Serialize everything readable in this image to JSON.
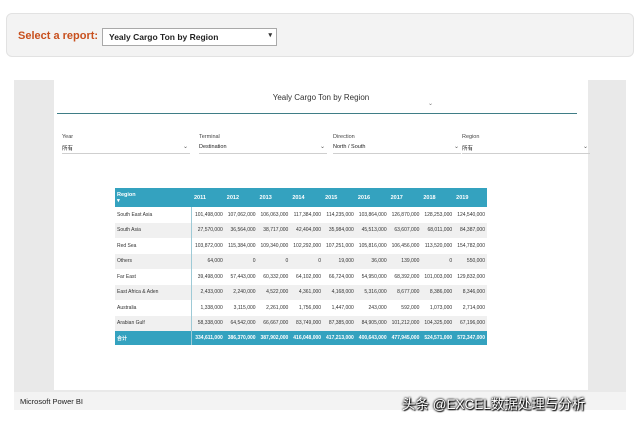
{
  "header": {
    "select_label": "Select a report:",
    "selected_report": "Yealy Cargo Ton by Region"
  },
  "report": {
    "title": "Yealy Cargo Ton by Region",
    "slicers": [
      {
        "label": "Year",
        "value": "所有"
      },
      {
        "label": "Terminal",
        "value": "Destination"
      },
      {
        "label": "Direction",
        "value": "North / South"
      },
      {
        "label": "Region",
        "value": "所有"
      }
    ],
    "table": {
      "columns": [
        "Region",
        "2011",
        "2012",
        "2013",
        "2014",
        "2015",
        "2016",
        "2017",
        "2018",
        "2019"
      ],
      "rows": [
        [
          "South East Asia",
          "101,498,000",
          "107,062,000",
          "106,063,000",
          "117,384,000",
          "114,235,000",
          "103,864,000",
          "126,870,000",
          "128,253,000",
          "124,540,000"
        ],
        [
          "South Asia",
          "27,570,000",
          "36,564,000",
          "38,717,000",
          "42,404,000",
          "35,984,000",
          "45,513,000",
          "63,607,000",
          "68,011,000",
          "84,387,000"
        ],
        [
          "Red Sea",
          "103,872,000",
          "115,384,000",
          "109,340,000",
          "102,292,000",
          "107,251,000",
          "105,816,000",
          "106,456,000",
          "113,520,000",
          "154,782,000"
        ],
        [
          "Others",
          "64,000",
          "0",
          "0",
          "0",
          "19,000",
          "36,000",
          "139,000",
          "0",
          "550,000"
        ],
        [
          "Far East",
          "39,498,000",
          "57,443,000",
          "60,332,000",
          "64,102,000",
          "66,724,000",
          "54,950,000",
          "68,392,000",
          "101,003,000",
          "129,832,000"
        ],
        [
          "East Africa & Aden",
          "2,433,000",
          "2,240,000",
          "4,522,000",
          "4,361,000",
          "4,168,000",
          "5,316,000",
          "8,677,000",
          "8,386,000",
          "8,346,000"
        ],
        [
          "Australia",
          "1,338,000",
          "3,115,000",
          "2,261,000",
          "1,756,000",
          "1,447,000",
          "243,000",
          "592,000",
          "1,073,000",
          "2,714,000"
        ],
        [
          "Arabian Gulf",
          "58,338,000",
          "64,542,000",
          "66,667,000",
          "83,749,000",
          "87,385,000",
          "84,905,000",
          "101,212,000",
          "104,325,000",
          "67,196,000"
        ]
      ],
      "total": [
        "合计",
        "334,611,000",
        "386,370,000",
        "387,902,000",
        "416,048,000",
        "417,213,000",
        "400,643,000",
        "477,945,000",
        "524,571,000",
        "572,347,000"
      ]
    }
  },
  "footer": {
    "brand": "Microsoft Power BI",
    "watermark": "头条 @EXCEL数据处理与分析"
  },
  "icons": {
    "dropdown_caret": "▾",
    "slicer_chevron": "⌄",
    "sort_indicator": "▾"
  },
  "colors": {
    "accent_orange": "#c8501e",
    "table_header": "#34a2bf",
    "title_rule": "#3f7d86"
  }
}
